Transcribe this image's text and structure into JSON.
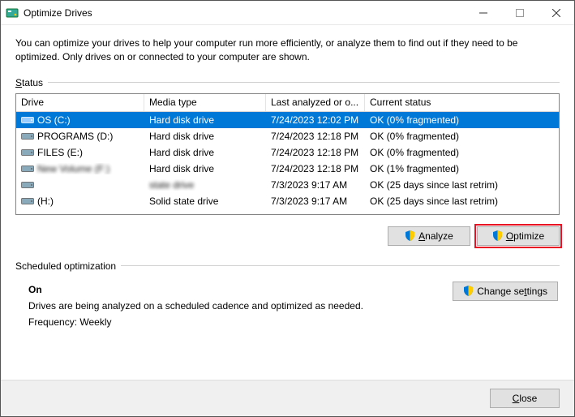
{
  "window": {
    "title": "Optimize Drives"
  },
  "description": "You can optimize your drives to help your computer run more efficiently, or analyze them to find out if they need to be optimized. Only drives on or connected to your computer are shown.",
  "status_label": "Status",
  "columns": {
    "drive": "Drive",
    "media": "Media type",
    "last": "Last analyzed or o...",
    "current": "Current status"
  },
  "drives": [
    {
      "name": "OS (C:)",
      "media": "Hard disk drive",
      "last": "7/24/2023 12:02 PM",
      "status": "OK (0% fragmented)",
      "selected": true,
      "icon": "hdd-win"
    },
    {
      "name": "PROGRAMS (D:)",
      "media": "Hard disk drive",
      "last": "7/24/2023 12:18 PM",
      "status": "OK (0% fragmented)",
      "icon": "hdd"
    },
    {
      "name": "FILES (E:)",
      "media": "Hard disk drive",
      "last": "7/24/2023 12:18 PM",
      "status": "OK (0% fragmented)",
      "icon": "hdd"
    },
    {
      "name": "New Volume (F:)",
      "media": "Hard disk drive",
      "last": "7/24/2023 12:18 PM",
      "status": "OK (1% fragmented)",
      "icon": "hdd",
      "blurName": true
    },
    {
      "name": "",
      "media": "state drive",
      "last": "7/3/2023 9:17 AM",
      "status": "OK (25 days since last retrim)",
      "icon": "hdd",
      "blurName": true,
      "blurMedia": true
    },
    {
      "name": "(H:)",
      "media": "Solid state drive",
      "last": "7/3/2023 9:17 AM",
      "status": "OK (25 days since last retrim)",
      "icon": "hdd"
    }
  ],
  "buttons": {
    "analyze": "Analyze",
    "optimize": "Optimize",
    "change_settings": "Change settings",
    "close": "Close"
  },
  "schedule": {
    "label": "Scheduled optimization",
    "state": "On",
    "desc": "Drives are being analyzed on a scheduled cadence and optimized as needed.",
    "freq": "Frequency: Weekly"
  }
}
